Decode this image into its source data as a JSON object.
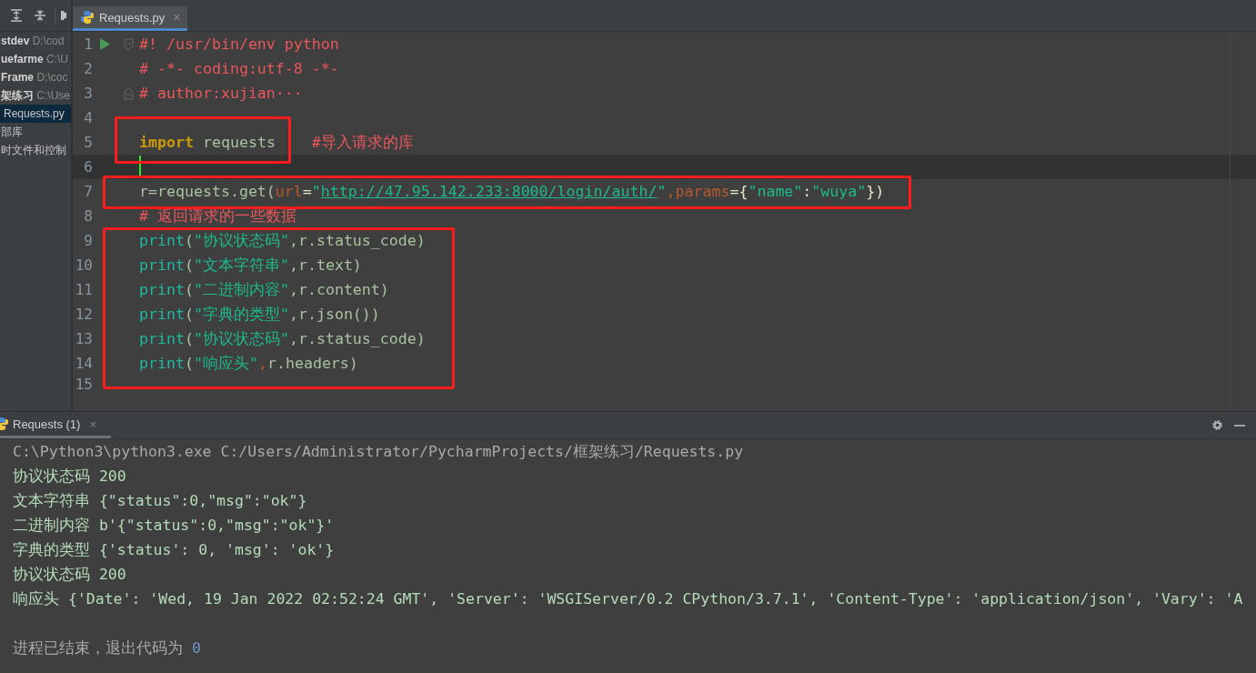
{
  "sidebar": {
    "items": [
      {
        "name": "stdev",
        "path": "D:\\cod",
        "selected": false,
        "kind": "project"
      },
      {
        "name": "uefarme",
        "path": "C:\\U",
        "selected": false,
        "kind": "project"
      },
      {
        "name": "Frame",
        "path": "D:\\coc",
        "selected": false,
        "kind": "project"
      },
      {
        "name": "架练习",
        "path": "C:\\Use",
        "selected": false,
        "kind": "project"
      },
      {
        "name": "Requests.py",
        "selected": true,
        "kind": "file"
      },
      {
        "name": "部库",
        "selected": false,
        "kind": "file"
      },
      {
        "name": "时文件和控制",
        "selected": false,
        "kind": "file"
      }
    ]
  },
  "editor_tab": {
    "title": "Requests.py",
    "close": "×"
  },
  "code_lines": [
    {
      "number": "1",
      "current": false,
      "runnable": true,
      "fold": {
        "kind": "start"
      },
      "tokens": [
        {
          "kind": "comment",
          "text": "#! /usr/bin/env python"
        }
      ]
    },
    {
      "number": "2",
      "current": false,
      "runnable": false,
      "tokens": [
        {
          "kind": "comment",
          "text": "# -*- coding:utf-8 -*-"
        }
      ]
    },
    {
      "number": "3",
      "current": false,
      "runnable": false,
      "fold": {
        "kind": "end"
      },
      "tokens": [
        {
          "kind": "comment",
          "text": "# author:xujian···"
        }
      ]
    },
    {
      "number": "4",
      "current": false,
      "runnable": false
    },
    {
      "number": "5",
      "current": false,
      "runnable": false,
      "tokens": [
        {
          "kind": "keyword",
          "text": "import"
        },
        {
          "kind": "ident",
          "text": " requests    "
        },
        {
          "kind": "comment",
          "text": "#导入请求的库"
        }
      ]
    },
    {
      "number": "6",
      "current": true,
      "runnable": false
    },
    {
      "number": "7",
      "current": false,
      "runnable": false,
      "tokens": [
        {
          "kind": "ident",
          "text": "r=requests.get("
        },
        {
          "kind": "param",
          "text": "url"
        },
        {
          "kind": "punct",
          "text": "="
        },
        {
          "kind": "string",
          "text": "\""
        },
        {
          "kind": "url",
          "text": "http://47.95.142.233:8000/login/auth/"
        },
        {
          "kind": "string",
          "text": "\""
        },
        {
          "kind": "param",
          "text": ",params"
        },
        {
          "kind": "punct",
          "text": "={"
        },
        {
          "kind": "string",
          "text": "\"name\""
        },
        {
          "kind": "punct",
          "text": ":"
        },
        {
          "kind": "string",
          "text": "\"wuya\""
        },
        {
          "kind": "punct",
          "text": "})"
        }
      ]
    },
    {
      "number": "8",
      "current": false,
      "runnable": false,
      "tokens": [
        {
          "kind": "comment",
          "text": "# 返回请求的一些数据"
        }
      ]
    },
    {
      "number": "9",
      "current": false,
      "runnable": false,
      "tokens": [
        {
          "kind": "builtin",
          "text": "print"
        },
        {
          "kind": "ident",
          "text": "("
        },
        {
          "kind": "string",
          "text": "\"协议状态码\""
        },
        {
          "kind": "ident",
          "text": ",r.status_code)"
        }
      ]
    },
    {
      "number": "10",
      "current": false,
      "runnable": false,
      "tokens": [
        {
          "kind": "builtin",
          "text": "print"
        },
        {
          "kind": "ident",
          "text": "("
        },
        {
          "kind": "string",
          "text": "\"文本字符串\""
        },
        {
          "kind": "ident",
          "text": ",r.text)"
        }
      ]
    },
    {
      "number": "11",
      "current": false,
      "runnable": false,
      "tokens": [
        {
          "kind": "builtin",
          "text": "print"
        },
        {
          "kind": "ident",
          "text": "("
        },
        {
          "kind": "string",
          "text": "\"二进制内容\""
        },
        {
          "kind": "ident",
          "text": ",r.content)"
        }
      ]
    },
    {
      "number": "12",
      "current": false,
      "runnable": false,
      "tokens": [
        {
          "kind": "builtin",
          "text": "print"
        },
        {
          "kind": "ident",
          "text": "("
        },
        {
          "kind": "string",
          "text": "\"字典的类型\""
        },
        {
          "kind": "ident",
          "text": ",r.json())"
        }
      ]
    },
    {
      "number": "13",
      "current": false,
      "runnable": false,
      "tokens": [
        {
          "kind": "builtin",
          "text": "print"
        },
        {
          "kind": "ident",
          "text": "("
        },
        {
          "kind": "string",
          "text": "\"协议状态码\""
        },
        {
          "kind": "ident",
          "text": ",r.status_code)"
        }
      ]
    },
    {
      "number": "14",
      "current": false,
      "runnable": false,
      "tokens": [
        {
          "kind": "builtin",
          "text": "print"
        },
        {
          "kind": "ident",
          "text": "("
        },
        {
          "kind": "string",
          "text": "\"响应头\""
        },
        {
          "kind": "param",
          "text": ","
        },
        {
          "kind": "ident",
          "text": "r.headers)"
        }
      ]
    },
    {
      "number": "15",
      "current": false,
      "runnable": false
    }
  ],
  "highlight_boxes": [
    {
      "kind": "rectangle"
    },
    {
      "kind": "rectangle"
    },
    {
      "kind": "rectangle"
    }
  ],
  "run_panel": {
    "tab": {
      "title": "Requests (1)",
      "close": "×"
    },
    "lines": [
      {
        "kind": "command",
        "text": "C:\\Python3\\python3.exe C:/Users/Administrator/PycharmProjects/框架练习/Requests.py"
      },
      {
        "kind": "output",
        "text": "协议状态码 200"
      },
      {
        "kind": "output",
        "text": "文本字符串 {\"status\":0,\"msg\":\"ok\"}"
      },
      {
        "kind": "output",
        "text": "二进制内容 b'{\"status\":0,\"msg\":\"ok\"}'"
      },
      {
        "kind": "output",
        "text": "字典的类型 {'status': 0, 'msg': 'ok'}"
      },
      {
        "kind": "output",
        "text": "协议状态码 200"
      },
      {
        "kind": "output",
        "text": "响应头 {'Date': 'Wed, 19 Jan 2022 02:52:24 GMT', 'Server': 'WSGIServer/0.2 CPython/3.7.1', 'Content-Type': 'application/json', 'Vary': 'A"
      },
      {
        "kind": "blank"
      },
      {
        "kind": "exit",
        "text": "进程已结束，退出代码为",
        "code": "0"
      }
    ]
  }
}
